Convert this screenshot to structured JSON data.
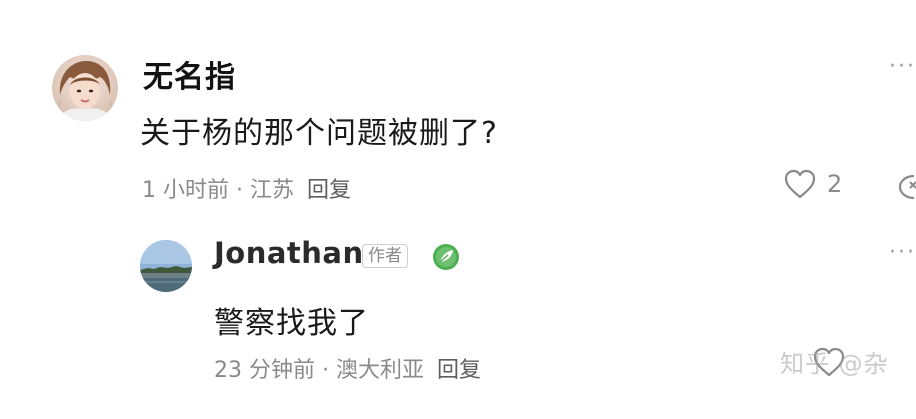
{
  "comment": {
    "username": "无名指",
    "text": "关于杨的那个问题被删了?",
    "time": "1 小时前",
    "separator": " · ",
    "location": "江苏",
    "reply_label": "回复",
    "like_count": "2",
    "more_label": "···"
  },
  "reply": {
    "username": "Jonathan",
    "author_tag": "作者",
    "text": "警察找我了",
    "time": "23 分钟前",
    "separator": " · ",
    "location": "澳大利亚",
    "reply_label": "回复",
    "more_label": "···"
  },
  "watermark": {
    "text": "知乎 @杂"
  },
  "colors": {
    "badge_green": "#4caf50",
    "meta_gray": "#8a8a8a",
    "text_dark": "#1a1a1a"
  }
}
